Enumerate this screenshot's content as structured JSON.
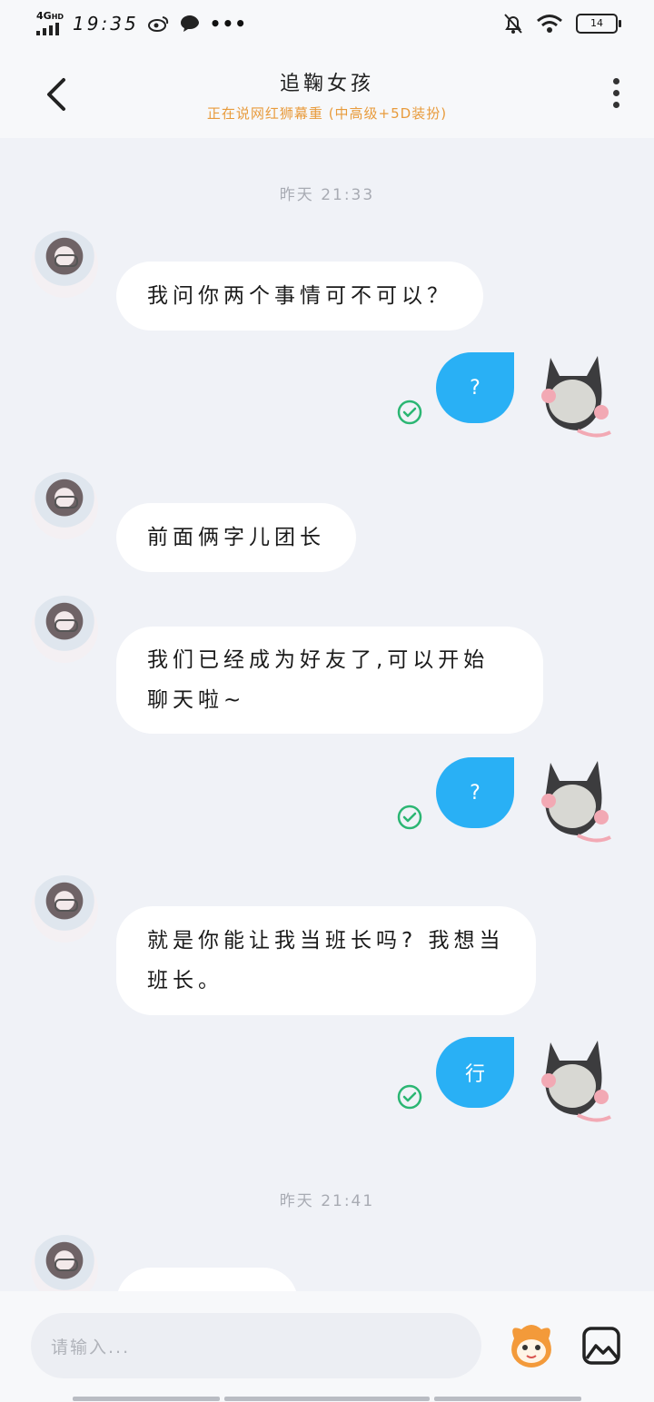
{
  "status_bar": {
    "network": "4G",
    "network_hd": "HD",
    "time": "19:35",
    "battery": "14"
  },
  "header": {
    "title": "追鞠女孩",
    "subtitle": "正在说网红狮幕重 (中高级+5D装扮)"
  },
  "messages": [
    {
      "type": "time",
      "text": "昨天 21:33"
    },
    {
      "type": "received",
      "text": "我问你两个事情可不可以？"
    },
    {
      "type": "sent",
      "text": "?"
    },
    {
      "type": "received",
      "text": "前面俩字儿团长"
    },
    {
      "type": "received",
      "text": "我们已经成为好友了,可以开始聊天啦~"
    },
    {
      "type": "sent",
      "text": "?"
    },
    {
      "type": "received",
      "text": "就是你能让我当班长吗? 我想当班长。"
    },
    {
      "type": "sent",
      "text": "行"
    },
    {
      "type": "time",
      "text": "昨天 21:41"
    }
  ],
  "input": {
    "placeholder": "请输入..."
  },
  "icons": {
    "back": "back-arrow-icon",
    "more": "more-vertical-icon",
    "emoji": "emoji-mascot-icon",
    "image": "image-icon",
    "check": "check-circle-icon"
  },
  "colors": {
    "sent_bubble": "#29b0f5",
    "check": "#2bb673",
    "subtitle": "#e89b3c"
  }
}
